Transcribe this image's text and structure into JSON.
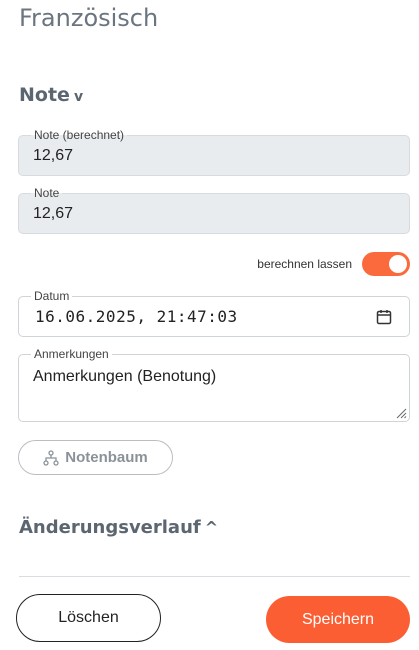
{
  "page": {
    "title": "Französisch"
  },
  "note_section": {
    "heading": "Note",
    "chevron": "v",
    "icon": "chevron-down-icon"
  },
  "fields": {
    "note_calculated": {
      "label": "Note (berechnet)",
      "value": "12,67"
    },
    "note": {
      "label": "Note",
      "value": "12,67"
    },
    "calculate_toggle": {
      "label": "berechnen lassen",
      "on": true
    },
    "date": {
      "label": "Datum",
      "value": "16.06.2025, 21:47:03"
    },
    "remarks": {
      "label": "Anmerkungen",
      "placeholder": "Anmerkungen (Benotung)"
    }
  },
  "tree_button": {
    "label": "Notenbaum",
    "icon": "hierarchy-icon"
  },
  "history_section": {
    "heading": "Änderungsverlauf",
    "chevron": "^",
    "icon": "chevron-up-icon"
  },
  "actions": {
    "delete_label": "Löschen",
    "save_label": "Speichern"
  },
  "colors": {
    "accent": "#fb5e33",
    "toggle_on": "#fb6a3c",
    "disabled_bg": "#e9ecef",
    "heading": "#5c6670"
  }
}
